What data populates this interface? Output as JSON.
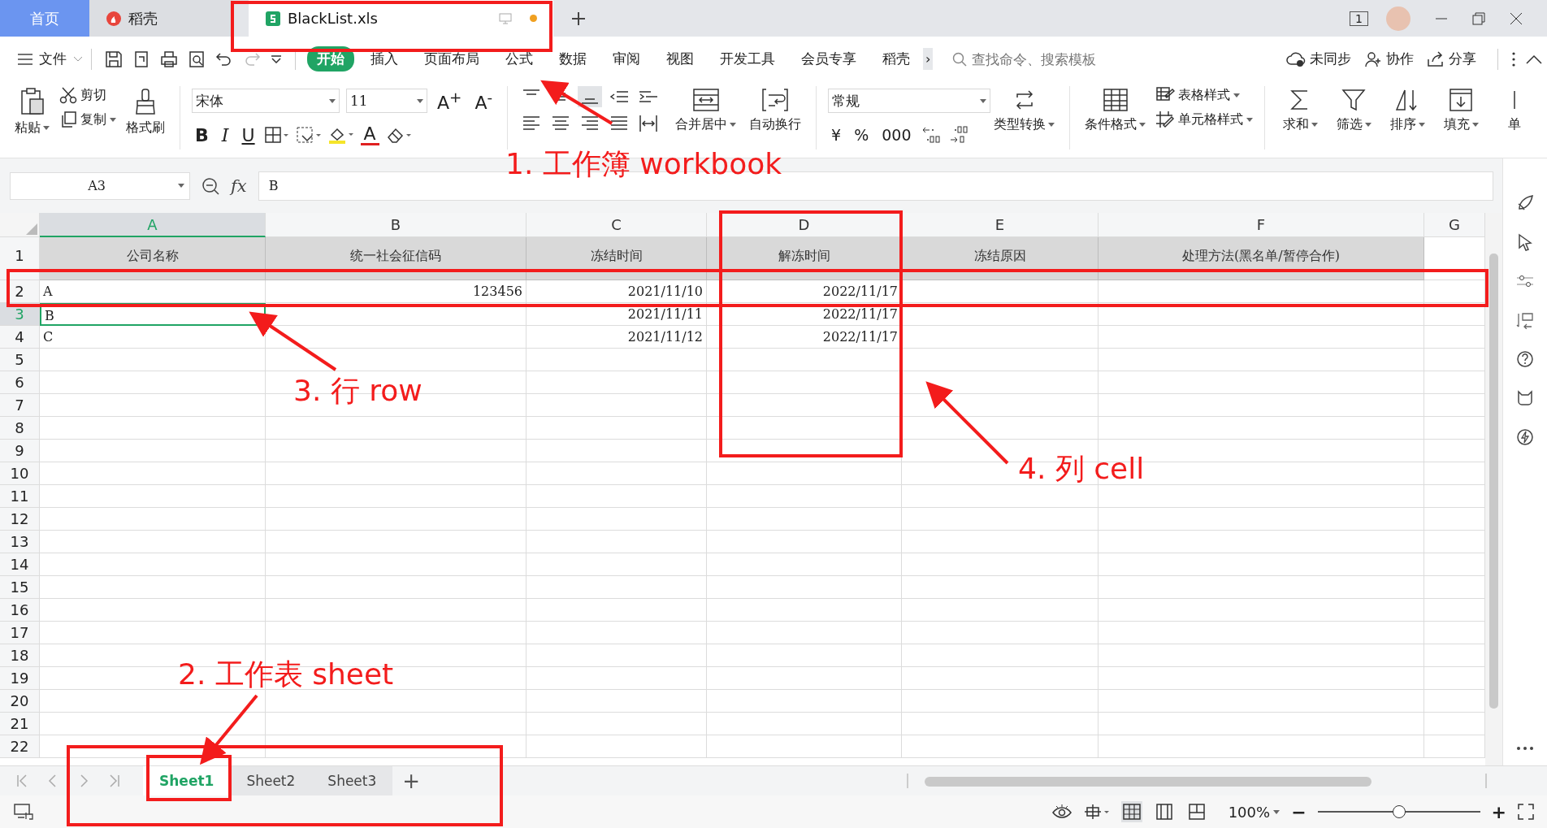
{
  "window_tabs": [
    {
      "label": "首页",
      "kind": "home",
      "selected": false
    },
    {
      "label": "稻壳",
      "kind": "app",
      "selected": false
    },
    {
      "label": "BlackList.xls",
      "kind": "file",
      "selected": true,
      "unsaved": true
    }
  ],
  "page_count": "1",
  "menu": {
    "file": "文件",
    "tabs": [
      {
        "label": "开始",
        "selected": true
      },
      {
        "label": "插入",
        "selected": false
      },
      {
        "label": "页面布局",
        "selected": false
      },
      {
        "label": "公式",
        "selected": false
      },
      {
        "label": "数据",
        "selected": false
      },
      {
        "label": "审阅",
        "selected": false
      },
      {
        "label": "视图",
        "selected": false
      },
      {
        "label": "开发工具",
        "selected": false
      },
      {
        "label": "会员专享",
        "selected": false
      },
      {
        "label": "稻壳",
        "selected": false
      }
    ],
    "more": "›",
    "search_placeholder": "查找命令、搜索模板",
    "actions": [
      "未同步",
      "协作",
      "分享"
    ]
  },
  "ribbon": {
    "paste": "粘贴",
    "cut": "剪切",
    "copy": "复制",
    "format_painter": "格式刷",
    "font_name": "宋体",
    "font_size": "11",
    "size_buttons": [
      "A$^{+}$",
      "A$^{-}$"
    ],
    "style_buttons": [
      "B",
      "I",
      "U"
    ],
    "font_color": "A",
    "merge": "合并居中",
    "wrap": "自动换行",
    "number_format": "常规",
    "number_buttons": [
      "¥",
      "%",
      "000"
    ],
    "type_convert": "类型转换",
    "conditional_format": "条件格式",
    "table_style": "表格样式",
    "cell_style": "单元格样式",
    "editing": [
      "求和",
      "筛选",
      "排序",
      "填充",
      "单"
    ]
  },
  "formula_bar": {
    "cell_name": "A3",
    "fx": "fx",
    "value": "B"
  },
  "columns": [
    {
      "label": "A",
      "kind": "text",
      "selected": true
    },
    {
      "label": "B",
      "kind": "number",
      "selected": false
    },
    {
      "label": "C",
      "kind": "number",
      "selected": false
    },
    {
      "label": "D",
      "kind": "number",
      "selected": false
    },
    {
      "label": "E",
      "kind": "text",
      "selected": false
    },
    {
      "label": "F",
      "kind": "text",
      "selected": false
    },
    {
      "label": "G",
      "kind": "text",
      "selected": false
    }
  ],
  "rows": [
    {
      "number": "1",
      "kind": "header",
      "selected": false,
      "cells": [
        "公司名称",
        "统一社会征信码",
        "冻结时间",
        "解冻时间",
        "冻结原因",
        "处理方法(黑名单/暂停合作)",
        ""
      ]
    },
    {
      "number": "2",
      "kind": "data",
      "selected": false,
      "cells": [
        "A",
        "123456",
        "2021/11/10",
        "2022/11/17",
        "",
        "",
        ""
      ]
    },
    {
      "number": "3",
      "kind": "data",
      "selected": true,
      "cells": [
        "B",
        "",
        "2021/11/11",
        "2022/11/17",
        "",
        "",
        ""
      ]
    },
    {
      "number": "4",
      "kind": "data",
      "selected": false,
      "cells": [
        "C",
        "",
        "2021/11/12",
        "2022/11/17",
        "",
        "",
        ""
      ]
    },
    {
      "number": "5",
      "kind": "data",
      "selected": false,
      "cells": []
    },
    {
      "number": "6",
      "kind": "data",
      "selected": false,
      "cells": []
    },
    {
      "number": "7",
      "kind": "data",
      "selected": false,
      "cells": []
    },
    {
      "number": "8",
      "kind": "data",
      "selected": false,
      "cells": []
    },
    {
      "number": "9",
      "kind": "data",
      "selected": false,
      "cells": []
    },
    {
      "number": "10",
      "kind": "data",
      "selected": false,
      "cells": []
    },
    {
      "number": "11",
      "kind": "data",
      "selected": false,
      "cells": []
    },
    {
      "number": "12",
      "kind": "data",
      "selected": false,
      "cells": []
    },
    {
      "number": "13",
      "kind": "data",
      "selected": false,
      "cells": []
    },
    {
      "number": "14",
      "kind": "data",
      "selected": false,
      "cells": []
    },
    {
      "number": "15",
      "kind": "data",
      "selected": false,
      "cells": []
    },
    {
      "number": "16",
      "kind": "data",
      "selected": false,
      "cells": []
    },
    {
      "number": "17",
      "kind": "data",
      "selected": false,
      "cells": []
    },
    {
      "number": "18",
      "kind": "data",
      "selected": false,
      "cells": []
    },
    {
      "number": "19",
      "kind": "data",
      "selected": false,
      "cells": []
    },
    {
      "number": "20",
      "kind": "data",
      "selected": false,
      "cells": []
    },
    {
      "number": "21",
      "kind": "data",
      "selected": false,
      "cells": []
    },
    {
      "number": "22",
      "kind": "data",
      "selected": false,
      "cells": []
    }
  ],
  "sheets": [
    {
      "label": "Sheet1",
      "selected": true
    },
    {
      "label": "Sheet2",
      "selected": false
    },
    {
      "label": "Sheet3",
      "selected": false
    }
  ],
  "add_sheet": "+",
  "status_bar": {
    "zoom": "100%",
    "zoom_minus": "−",
    "zoom_plus": "+",
    "level": 0.5
  },
  "annotations": [
    {
      "label": "1. 工作簿 workbook",
      "kind": "workbook"
    },
    {
      "label": "3. 行 row",
      "kind": "row"
    },
    {
      "label": "4. 列 cell",
      "kind": "column"
    },
    {
      "label": "2. 工作表 sheet",
      "kind": "sheet"
    }
  ]
}
